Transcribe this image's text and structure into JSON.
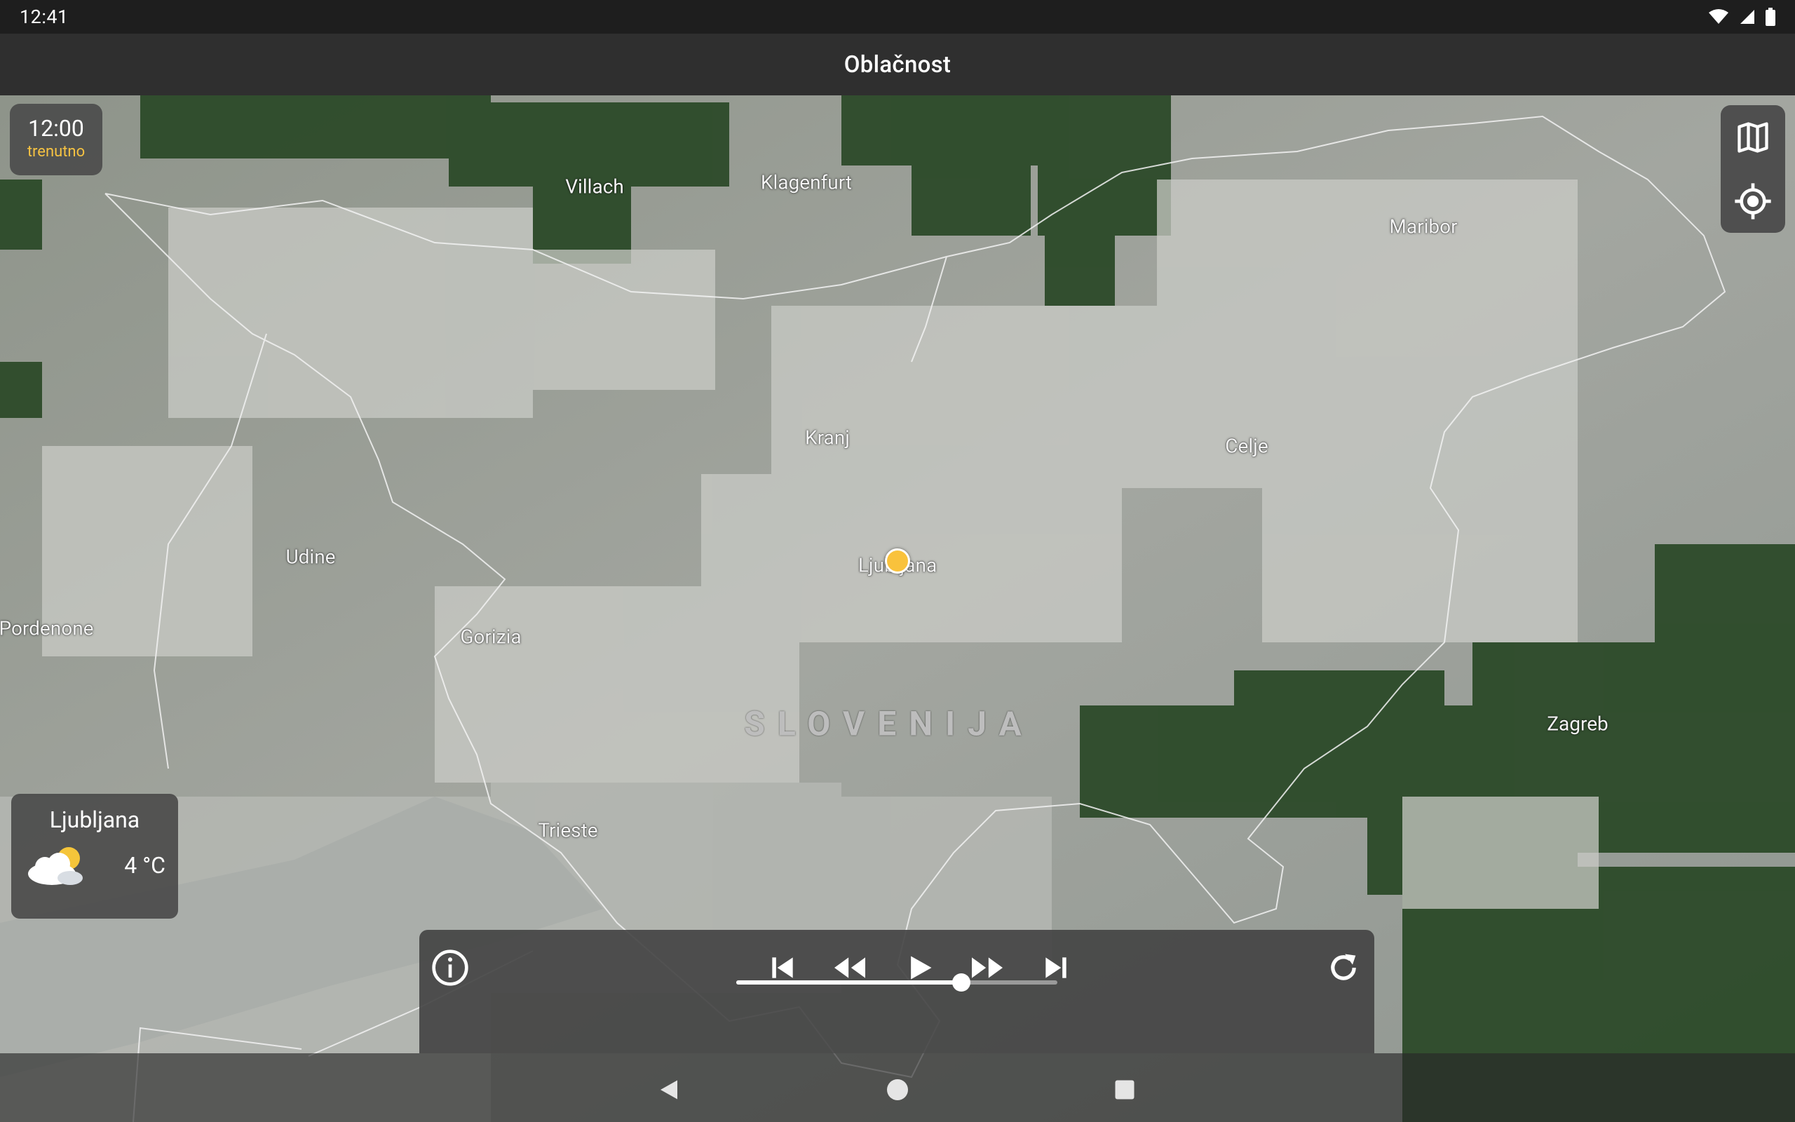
{
  "status_bar": {
    "time": "12:41"
  },
  "app_bar": {
    "title": "Oblačnost"
  },
  "time_badge": {
    "time": "12:00",
    "label": "trenutno"
  },
  "map": {
    "cities": [
      {
        "name": "Villach"
      },
      {
        "name": "Klagenfurt"
      },
      {
        "name": "Maribor"
      },
      {
        "name": "Kranj"
      },
      {
        "name": "Celje"
      },
      {
        "name": "Udine"
      },
      {
        "name": "Ljubljana"
      },
      {
        "name": "Pordenone"
      },
      {
        "name": "Gorizia"
      },
      {
        "name": "Zagreb"
      },
      {
        "name": "Trieste"
      }
    ],
    "country_label": "SLOVENIJA",
    "colors": {
      "marker": "#f9c23c"
    }
  },
  "weather_card": {
    "city": "Ljubljana",
    "temperature": "4 °C",
    "icon": "partly-cloudy-icon"
  },
  "player": {
    "progress_fraction": 0.7,
    "icons": [
      "info-icon",
      "skip-previous-icon",
      "rewind-icon",
      "play-icon",
      "fast-forward-icon",
      "skip-next-icon",
      "refresh-icon"
    ]
  },
  "side_tools": {
    "icons": [
      "map-layers-icon",
      "my-location-icon"
    ]
  },
  "nav_bar": {
    "icons": [
      "back-icon",
      "home-icon",
      "recents-icon"
    ]
  }
}
